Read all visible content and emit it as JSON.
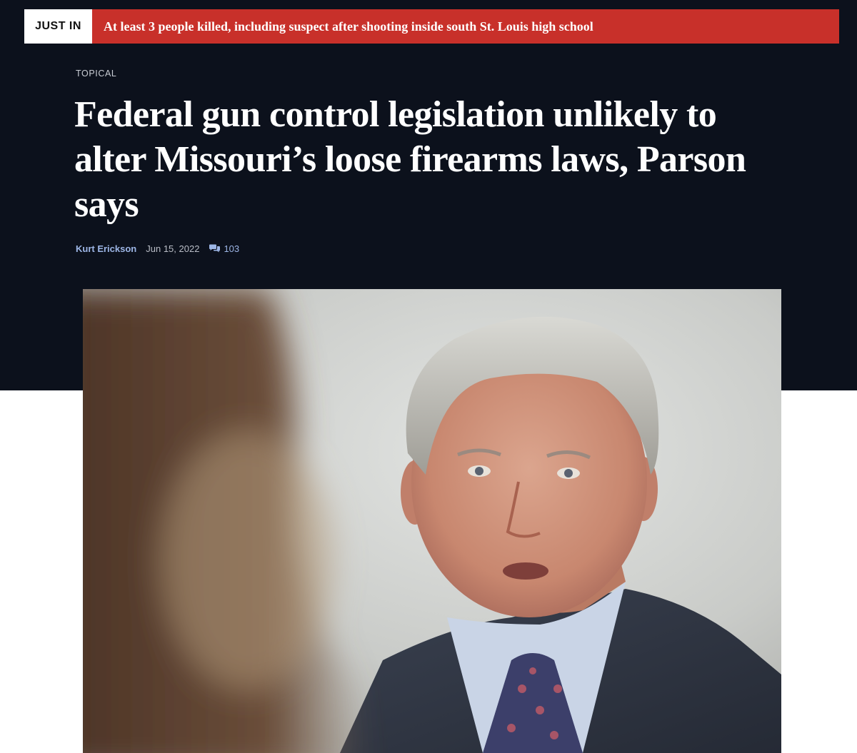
{
  "breaking": {
    "label": "JUST IN",
    "text": "At least 3 people killed, including suspect after shooting inside south St. Louis high school"
  },
  "article": {
    "section": "TOPICAL",
    "headline": "Federal gun control legislation unlikely to alter Missouri’s loose firearms laws, Parson says",
    "author": "Kurt Erickson",
    "date": "Jun 15, 2022",
    "comment_count": "103",
    "image": "photo of a gray-haired man in a dark suit and patterned tie speaking, blurred figure in foreground"
  },
  "colors": {
    "header_bg": "#0c111c",
    "breaking_red": "#c8302a",
    "link_blue": "#9db6e6"
  },
  "icons": {
    "comments": "speech-bubbles-icon"
  }
}
